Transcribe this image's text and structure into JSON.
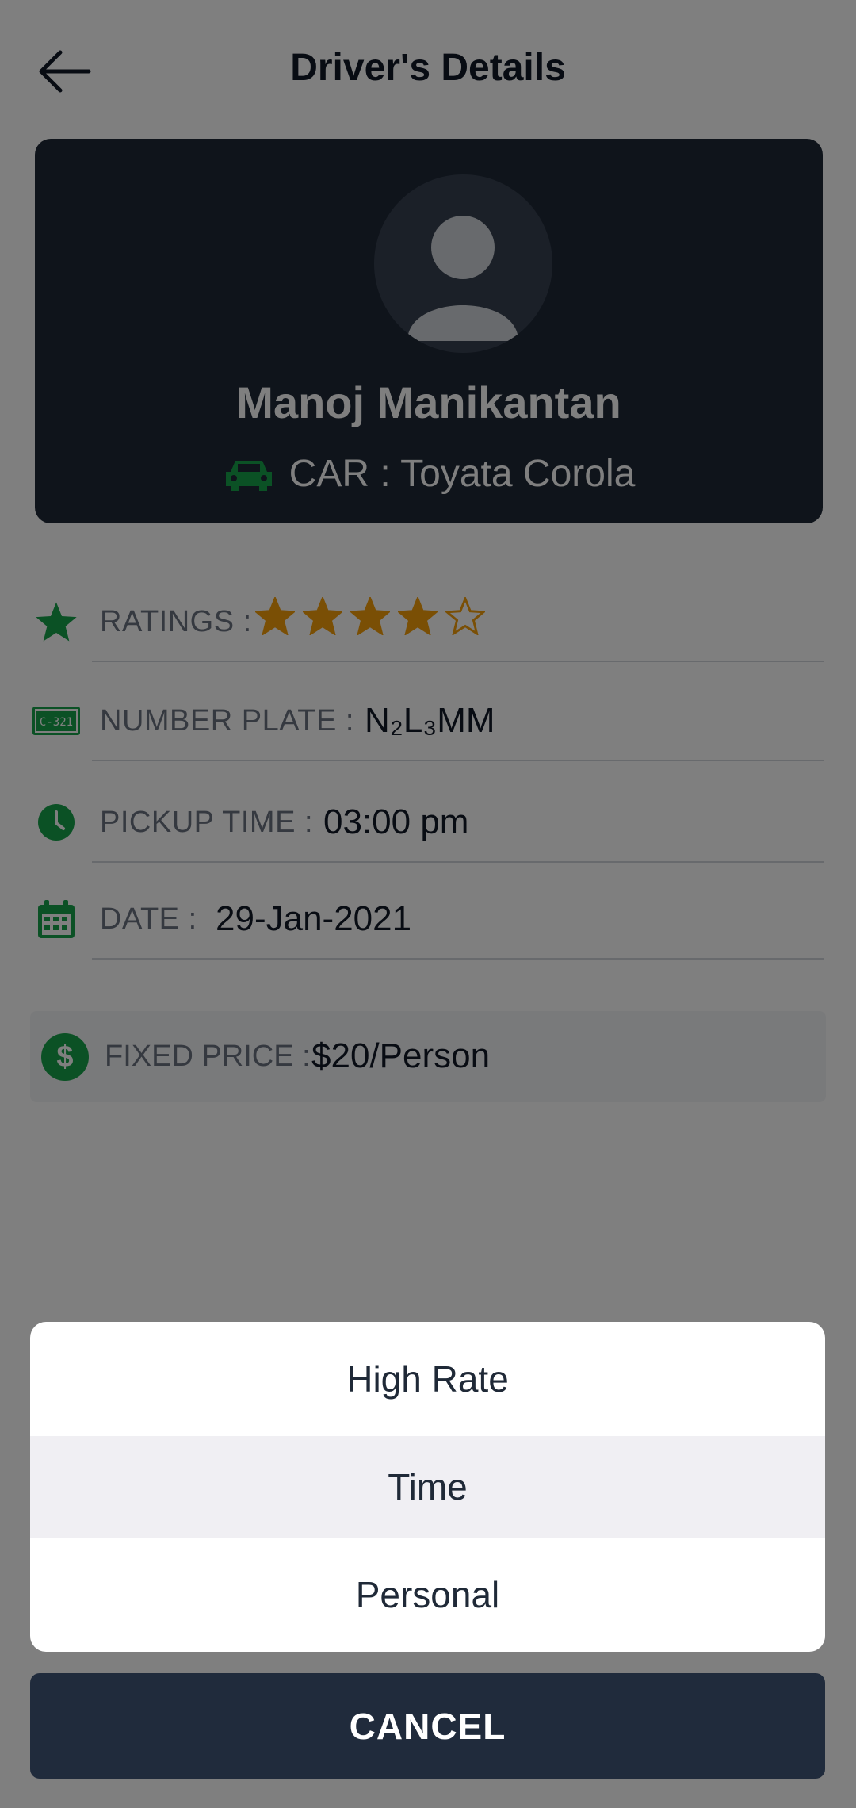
{
  "header": {
    "title": "Driver's Details",
    "back_icon": "arrow-left-icon"
  },
  "driver": {
    "name": "Manoj Manikantan",
    "car_label": "CAR : Toyata Corola"
  },
  "details": {
    "ratings": {
      "label": "RATINGS :",
      "value": 4,
      "max": 5
    },
    "number_plate": {
      "label": "NUMBER PLATE :",
      "value": "N₂L₃MM",
      "icon_text": "C-321"
    },
    "pickup_time": {
      "label": "PICKUP TIME :",
      "value": "03:00 pm"
    },
    "date": {
      "label": "DATE :",
      "value": "29-Jan-2021"
    },
    "fixed_price": {
      "label": "FIXED PRICE :",
      "value": "$20/Person",
      "icon_text": "$"
    }
  },
  "action_sheet": {
    "options": [
      "High Rate",
      "Time",
      "Personal"
    ],
    "cancel_label": "CANCEL"
  },
  "colors": {
    "accent": "#16a34a",
    "star": "#f59e0b",
    "card": "#1f2937",
    "overlay": "rgba(0,0,0,0.5)"
  }
}
